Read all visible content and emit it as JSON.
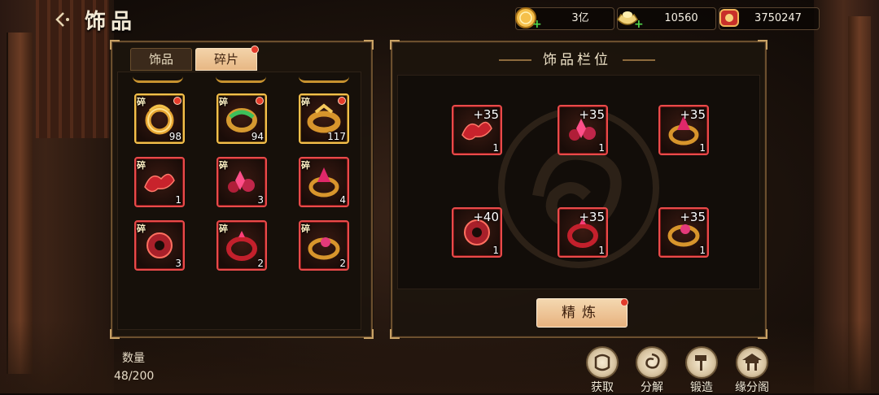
{
  "header": {
    "title": "饰品",
    "back_icon": "back-arrow-icon"
  },
  "currencies": [
    {
      "name": "gold-coin",
      "icon": "gold-coin-icon",
      "value": "3亿",
      "color": "#f5c04b"
    },
    {
      "name": "silver-ingot",
      "icon": "ingot-icon",
      "value": "10560",
      "color": "#e9d9a8"
    },
    {
      "name": "red-token",
      "icon": "red-token-icon",
      "value": "3750247",
      "color": "#d43a2a"
    }
  ],
  "tabs": [
    {
      "label": "饰品",
      "active": false
    },
    {
      "label": "碎片",
      "active": true,
      "badge": true
    }
  ],
  "fragment_label": "碎",
  "fragments": [
    {
      "count": "98",
      "rarity": "gold",
      "dot": true,
      "art": "ring-gold"
    },
    {
      "count": "94",
      "rarity": "gold",
      "dot": true,
      "art": "bangle-jade"
    },
    {
      "count": "117",
      "rarity": "gold",
      "dot": true,
      "art": "ring-gold-band"
    },
    {
      "count": "1",
      "rarity": "red",
      "dot": false,
      "art": "red-phoenix"
    },
    {
      "count": "3",
      "rarity": "red",
      "dot": false,
      "art": "red-gem-cluster"
    },
    {
      "count": "4",
      "rarity": "red",
      "dot": false,
      "art": "red-crown-ring"
    },
    {
      "count": "3",
      "rarity": "red",
      "dot": false,
      "art": "red-disc"
    },
    {
      "count": "2",
      "rarity": "red",
      "dot": false,
      "art": "red-ring"
    },
    {
      "count": "2",
      "rarity": "red",
      "dot": false,
      "art": "red-gold-ring"
    }
  ],
  "equip_section": {
    "title": "饰品栏位"
  },
  "equipped": [
    {
      "plus": "+35",
      "count": "1",
      "art": "red-phoenix"
    },
    {
      "plus": "+35",
      "count": "1",
      "art": "red-gem-cluster"
    },
    {
      "plus": "+35",
      "count": "1",
      "art": "red-crown-ring"
    },
    {
      "plus": "+40",
      "count": "1",
      "art": "red-disc"
    },
    {
      "plus": "+35",
      "count": "1",
      "art": "red-ring"
    },
    {
      "plus": "+35",
      "count": "1",
      "art": "red-gold-ring"
    }
  ],
  "refine_button": {
    "label": "精炼",
    "badge": true
  },
  "quantity": {
    "label": "数量",
    "value": "48/200"
  },
  "actions": [
    {
      "label": "获取",
      "icon": "scroll-icon"
    },
    {
      "label": "分解",
      "icon": "swirl-icon"
    },
    {
      "label": "锻造",
      "icon": "hammer-icon"
    },
    {
      "label": "缘分阁",
      "icon": "pavilion-icon"
    }
  ]
}
